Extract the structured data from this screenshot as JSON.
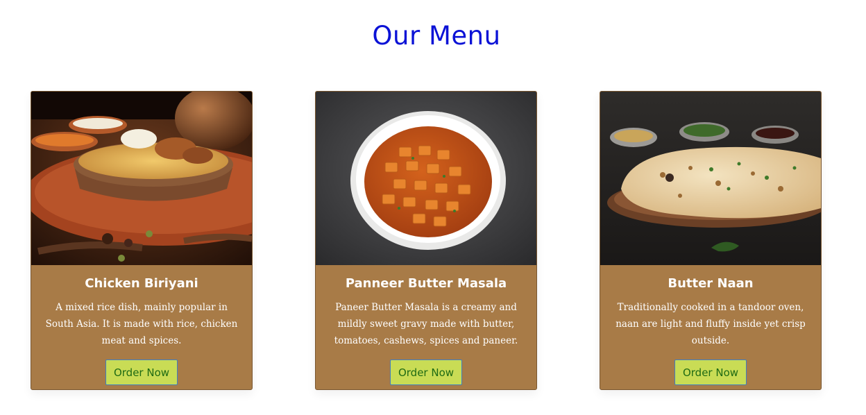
{
  "page": {
    "title": "Our Menu",
    "title_color": "#0b12d6"
  },
  "theme": {
    "card_bg": "#a87b47",
    "button_bg": "#c9dc55",
    "button_text": "#1f6b14",
    "button_border": "#3f7fc0"
  },
  "menu": {
    "items": [
      {
        "name": "Chicken Biriyani",
        "description": "A mixed rice dish, mainly popular in South Asia. It is made with rice, chicken meat and spices.",
        "button_label": "Order Now",
        "photo_alt": "Chicken biriyani served in a copper bowl"
      },
      {
        "name": "Panneer Butter Masala",
        "description": "Paneer Butter Masala is a creamy and mildly sweet gravy made with butter, tomatoes, cashews, spices and paneer.",
        "button_label": "Order Now",
        "photo_alt": "Paneer butter masala in a white bowl"
      },
      {
        "name": "Butter Naan",
        "description": "Traditionally cooked in a tandoor oven, naan are light and fluffy inside yet crisp outside.",
        "button_label": "Order Now",
        "photo_alt": "Butter naan on a wooden board with dips"
      }
    ]
  }
}
